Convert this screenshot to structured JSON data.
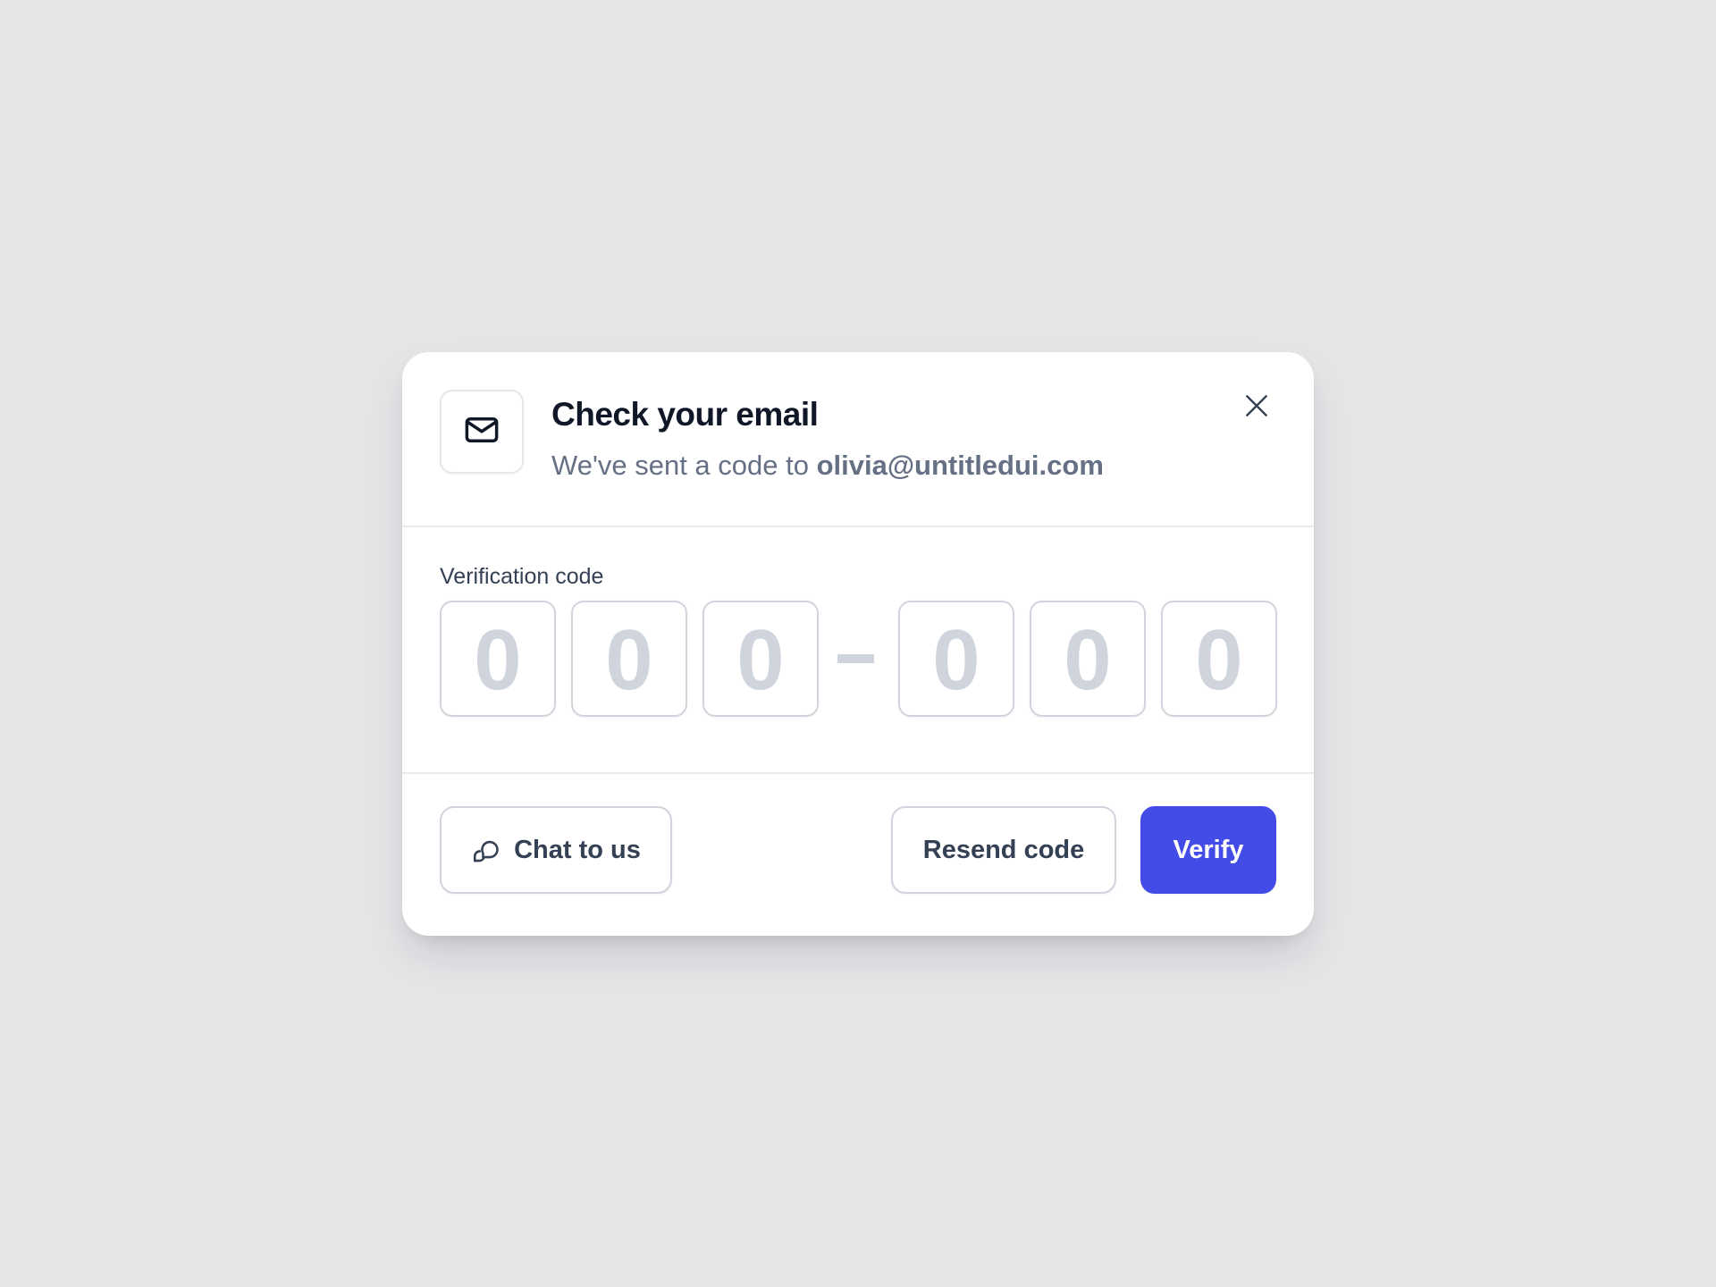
{
  "modal": {
    "title": "Check your email",
    "subtitle_prefix": "We've sent a code to ",
    "email": "olivia@untitledui.com",
    "header_icon": "mail-icon",
    "close_icon": "close-icon"
  },
  "verification": {
    "label": "Verification code",
    "digits": [
      {
        "placeholder": "0",
        "value": ""
      },
      {
        "placeholder": "0",
        "value": ""
      },
      {
        "placeholder": "0",
        "value": ""
      },
      {
        "placeholder": "0",
        "value": ""
      },
      {
        "placeholder": "0",
        "value": ""
      },
      {
        "placeholder": "0",
        "value": ""
      }
    ],
    "separator": "–"
  },
  "footer": {
    "chat_label": "Chat to us",
    "chat_icon": "message-chat-icon",
    "resend_label": "Resend code",
    "verify_label": "Verify"
  },
  "colors": {
    "background": "#e4e5e7",
    "primary": "#444ce7",
    "placeholder": "#d0d5dd",
    "title": "#101828",
    "muted": "#667085"
  }
}
